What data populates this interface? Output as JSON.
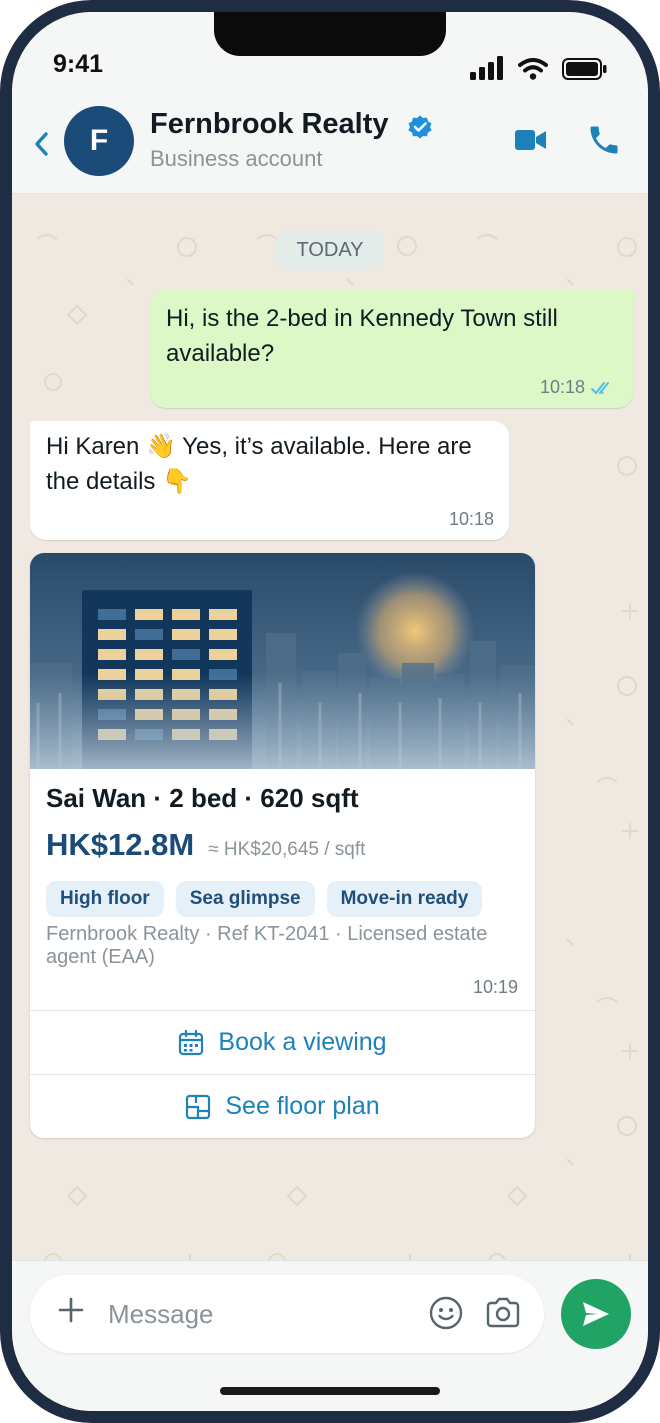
{
  "status_bar": {
    "time": "9:41"
  },
  "header": {
    "avatar_initial": "F",
    "name": "Fernbrook Realty",
    "subtitle": "Business account",
    "verified": true,
    "icons": [
      "chevron-left-icon",
      "verified-icon",
      "video-camera-icon",
      "phone-icon"
    ]
  },
  "chat": {
    "date_chip": "TODAY",
    "messages": [
      {
        "direction": "outgoing",
        "text": "Hi, is the 2-bed in Kennedy Town still available?",
        "time": "10:18",
        "status": "read"
      },
      {
        "direction": "incoming",
        "text": "Hi Karen 👋 Yes, it’s available. Here are the details 👇",
        "time": "10:18"
      }
    ],
    "listing_card": {
      "title": "Sai Wan · 2 bed · 620 sqft",
      "price": "HK$12.8M",
      "price_per_sqft": "≈ HK$20,645 / sqft",
      "tags": [
        "High floor",
        "Sea glimpse",
        "Move-in ready"
      ],
      "agent_line": "Fernbrook Realty · Ref KT-2041 · Licensed estate agent (EAA)",
      "time": "10:19",
      "buttons": {
        "book_viewing": "Book a viewing",
        "floor_plan": "See floor plan"
      }
    }
  },
  "composer": {
    "placeholder": "Message",
    "icons": [
      "plus-icon",
      "emoji-icon",
      "camera-icon",
      "send-icon"
    ]
  },
  "colors": {
    "accent_blue": "#1c82b9",
    "brand_navy": "#1b4b78",
    "outgoing_bubble": "#dcf8c6",
    "send_green": "#21a366",
    "chat_wallpaper": "#efe9e1"
  }
}
